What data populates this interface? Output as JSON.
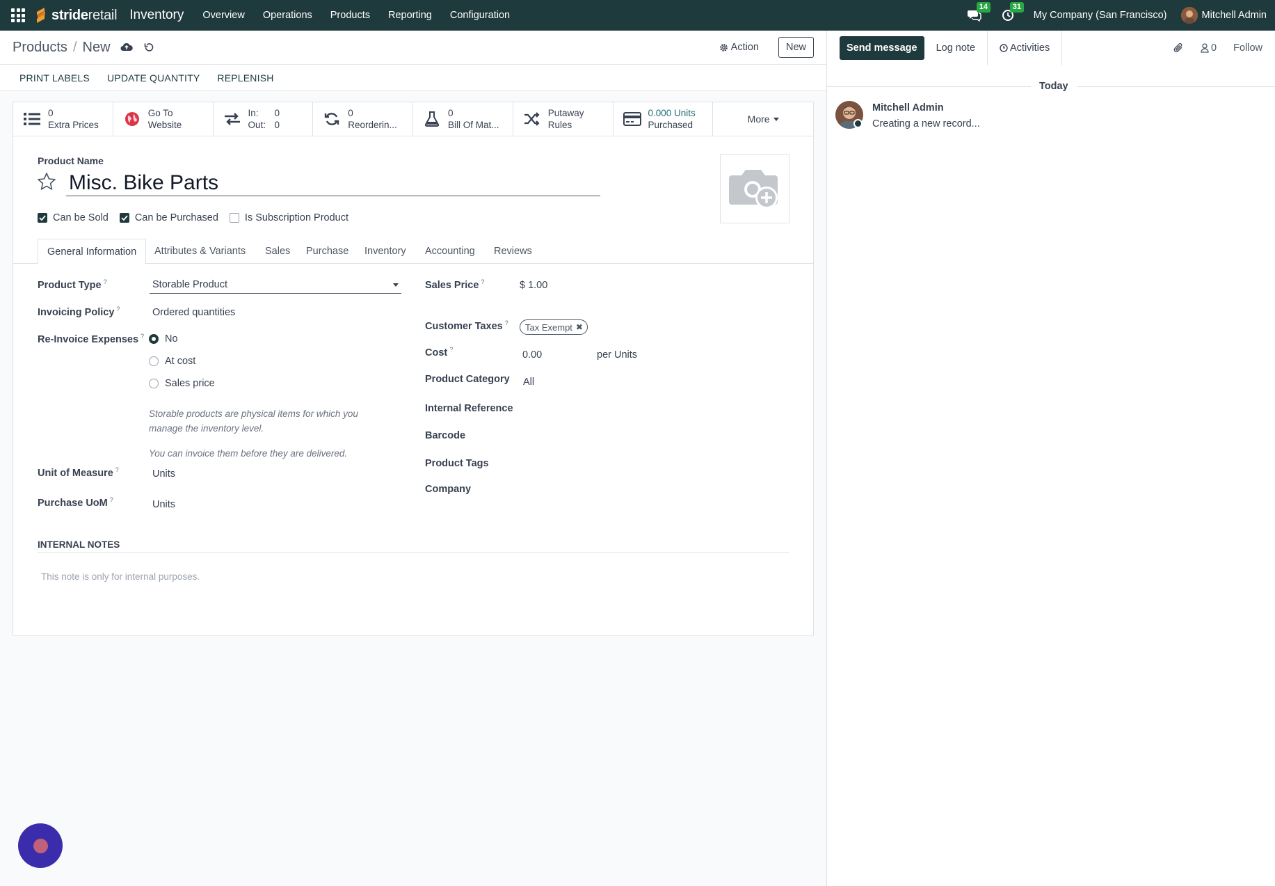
{
  "nav": {
    "brand_bold": "stride",
    "brand_light": "retail",
    "app": "Inventory",
    "menu": [
      "Overview",
      "Operations",
      "Products",
      "Reporting",
      "Configuration"
    ],
    "messages_count": "14",
    "activities_count": "31",
    "company": "My Company (San Francisco)",
    "user": "Mitchell Admin"
  },
  "control": {
    "crumb_parent": "Products",
    "crumb_current": "New",
    "action_label": "Action",
    "new_label": "New"
  },
  "statusbar": [
    "PRINT LABELS",
    "UPDATE QUANTITY",
    "REPLENISH"
  ],
  "smart_buttons": {
    "extra_prices": {
      "value": "0",
      "label": "Extra Prices"
    },
    "website": {
      "line1": "Go To",
      "line2": "Website"
    },
    "in_out": {
      "in_label": "In:",
      "in_value": "0",
      "out_label": "Out:",
      "out_value": "0"
    },
    "reordering": {
      "value": "0",
      "label": "Reorderin..."
    },
    "bom": {
      "value": "0",
      "label": "Bill Of Mat..."
    },
    "putaway": {
      "line1": "Putaway",
      "line2": "Rules"
    },
    "purchased": {
      "value": "0.000 Units",
      "label": "Purchased"
    },
    "more": "More"
  },
  "form": {
    "name_label": "Product Name",
    "name_value": "Misc. Bike Parts",
    "checks": [
      {
        "label": "Can be Sold",
        "checked": true
      },
      {
        "label": "Can be Purchased",
        "checked": true
      },
      {
        "label": "Is Subscription Product",
        "checked": false
      }
    ],
    "tabs": [
      "General Information",
      "Attributes & Variants",
      "Sales",
      "Purchase",
      "Inventory",
      "Accounting",
      "Reviews"
    ],
    "product_type_label": "Product Type",
    "product_type_value": "Storable Product",
    "invoicing_policy_label": "Invoicing Policy",
    "invoicing_policy_value": "Ordered quantities",
    "reinvoice_label": "Re-Invoice Expenses",
    "reinvoice_options": [
      "No",
      "At cost",
      "Sales price"
    ],
    "reinvoice_selected": "No",
    "help_1": "Storable products are physical items for which you manage the inventory level.",
    "help_2": "You can invoice them before they are delivered.",
    "uom_label": "Unit of Measure",
    "uom_value": "Units",
    "purchase_uom_label": "Purchase UoM",
    "purchase_uom_value": "Units",
    "sales_price_label": "Sales Price",
    "sales_price_value": "$ 1.00",
    "customer_taxes_label": "Customer Taxes",
    "customer_taxes_tag": "Tax Exempt",
    "cost_label": "Cost",
    "cost_value": "0.00",
    "cost_unit": "per Units",
    "category_label": "Product Category",
    "category_value": "All",
    "internal_ref_label": "Internal Reference",
    "barcode_label": "Barcode",
    "tags_label": "Product Tags",
    "company_label": "Company",
    "help_mark": "?",
    "notes_header": "INTERNAL NOTES",
    "notes_placeholder": "This note is only for internal purposes."
  },
  "chatter": {
    "send_message": "Send message",
    "log_note": "Log note",
    "activities": "Activities",
    "followers_count": "0",
    "follow": "Follow",
    "today": "Today",
    "author": "Mitchell Admin",
    "body": "Creating a new record..."
  },
  "colors": {
    "nav_bg": "#1f3a3d",
    "accent": "#1f3a3d",
    "badge": "#28a745",
    "fab": "#3b2cab"
  }
}
